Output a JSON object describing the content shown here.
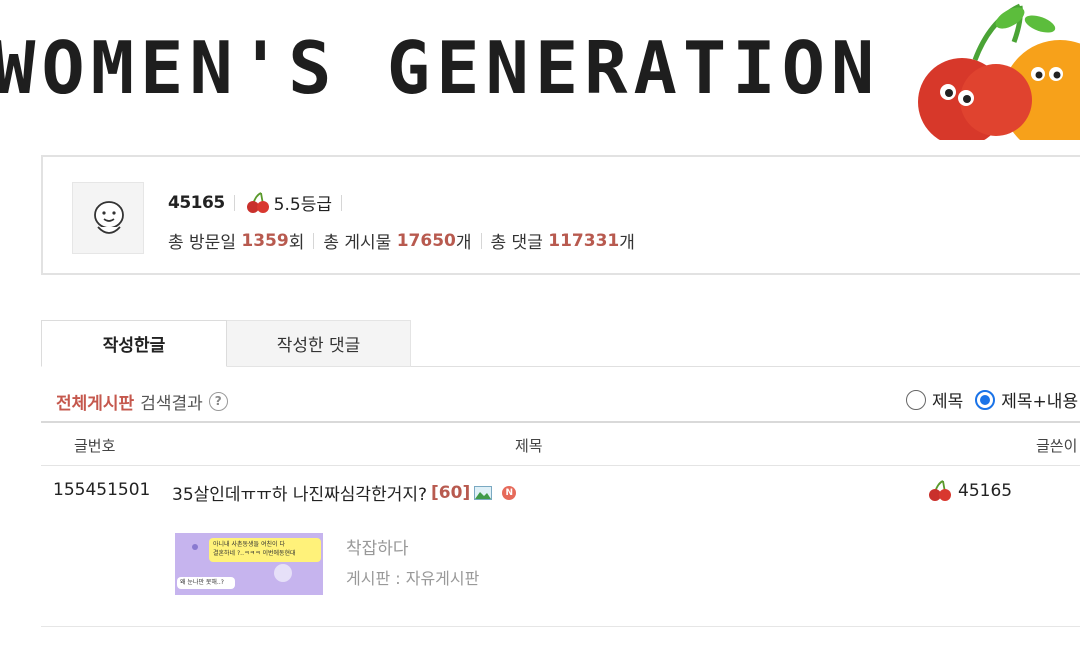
{
  "banner": {
    "title": "WOMEN'S GENERATION"
  },
  "profile": {
    "nickname": "45165",
    "grade": "5.5등급",
    "visits_label_pre": "총 방문일",
    "visits": "1359",
    "visits_unit": "회",
    "posts_label_pre": "총 게시물",
    "posts": "17650",
    "posts_unit": "개",
    "comments_label_pre": "총 댓글",
    "comments": "117331",
    "comments_unit": "개"
  },
  "tabs": [
    {
      "label": "작성한글"
    },
    {
      "label": "작성한 댓글"
    }
  ],
  "search": {
    "board": "전체게시판",
    "result_label": "검색결과",
    "help": "?",
    "options": [
      "제목",
      "제목+내용"
    ],
    "selected": "제목+내용"
  },
  "table": {
    "headers": {
      "num": "글번호",
      "title": "제목",
      "author": "글쓴이"
    },
    "rows": [
      {
        "num": "155451501",
        "title": "35살인데ㅠㅠ하 나진짜심각한거지?",
        "comments": "[60]",
        "badge": "N",
        "author": "45165",
        "preview": "착잡하다",
        "board": "게시판 : 자유게시판",
        "thumb_text_1": "아니내 사촌동생들 여친이 다",
        "thumb_text_2": "결혼하네 ?..ㅋㅋㅋ 이번에동현대",
        "thumb_text_3": "왜 눈나만 못해..?"
      }
    ]
  },
  "colors": {
    "accent": "#c5584d",
    "radio": "#1a73e8"
  }
}
